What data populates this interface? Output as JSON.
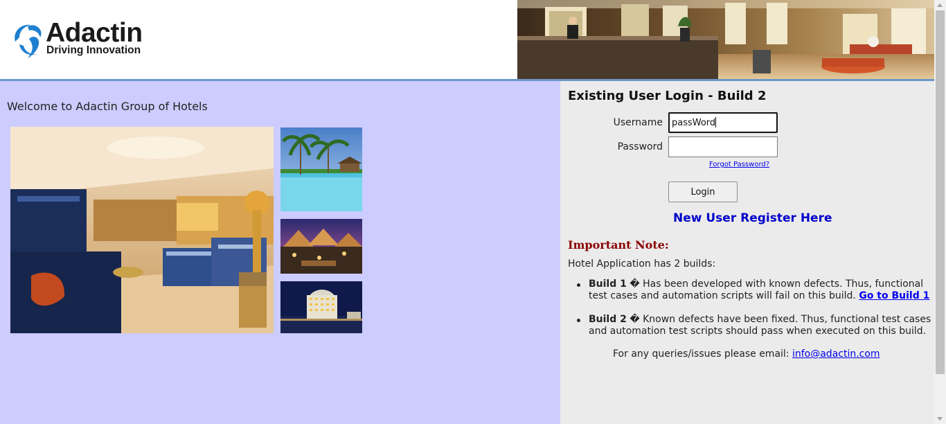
{
  "header": {
    "brand": "Adactin",
    "tagline": "Driving Innovation",
    "logo_icon": "blue-swirl-logo-icon",
    "banner_image": "hotel-lobby-banner"
  },
  "left": {
    "welcome": "Welcome to Adactin Group of Hotels",
    "images": [
      "luxury-suite-photo",
      "resort-pool-photo",
      "tent-resort-dusk-photo",
      "hotel-night-photo"
    ]
  },
  "login": {
    "title": "Existing User Login - Build 2",
    "username_label": "Username",
    "username_value": "passWord",
    "password_label": "Password",
    "password_value": "",
    "forgot": "Forgot Password?",
    "button": "Login",
    "register": "New User Register Here"
  },
  "note": {
    "title": "Important Note:",
    "subtitle": "Hotel Application has 2 builds:",
    "builds": [
      {
        "name": "Build 1",
        "text": " � Has been developed with known defects. Thus, functional test cases and automation scripts will fail on this build. ",
        "link": "Go to Build 1"
      },
      {
        "name": "Build 2",
        "text": " � Known defects have been fixed. Thus, functional test cases and automation test scripts should pass when executed on this build.",
        "link": ""
      }
    ],
    "contact_text": "For any queries/issues please email: ",
    "contact_email": "info@adactin.com"
  },
  "colors": {
    "left_bg": "#ccccff",
    "right_bg": "#ebebeb",
    "note_title": "#8b0000",
    "register_link": "#0000cc",
    "header_rule": "#6c97c9"
  }
}
